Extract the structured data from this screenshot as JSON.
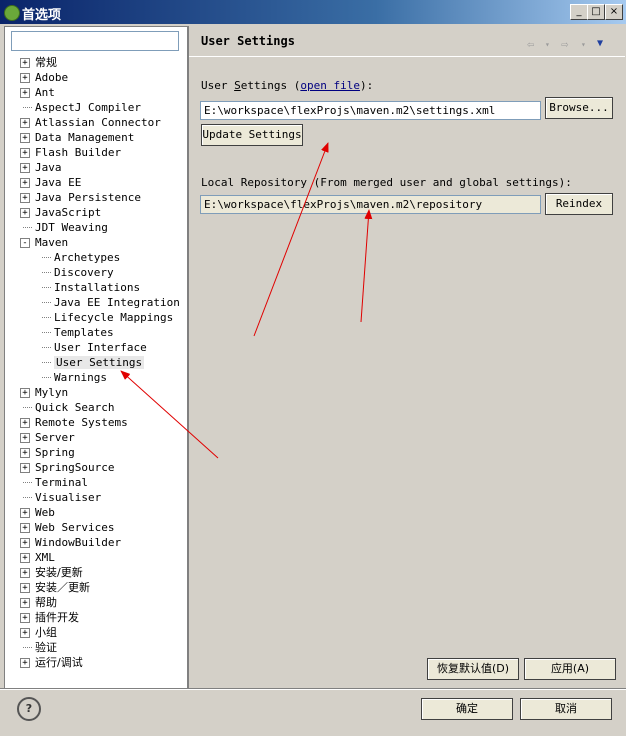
{
  "window": {
    "title": "首选项",
    "minimize": "_",
    "maximize": "□",
    "close": "×"
  },
  "tree": {
    "filter_value": "",
    "items": [
      {
        "label": "常规",
        "expander": "+",
        "level": 0
      },
      {
        "label": "Adobe",
        "expander": "+",
        "level": 0
      },
      {
        "label": "Ant",
        "expander": "+",
        "level": 0
      },
      {
        "label": "AspectJ Compiler",
        "expander": "",
        "level": 0
      },
      {
        "label": "Atlassian Connector",
        "expander": "+",
        "level": 0
      },
      {
        "label": "Data Management",
        "expander": "+",
        "level": 0
      },
      {
        "label": "Flash Builder",
        "expander": "+",
        "level": 0
      },
      {
        "label": "Java",
        "expander": "+",
        "level": 0
      },
      {
        "label": "Java EE",
        "expander": "+",
        "level": 0
      },
      {
        "label": "Java Persistence",
        "expander": "+",
        "level": 0
      },
      {
        "label": "JavaScript",
        "expander": "+",
        "level": 0
      },
      {
        "label": "JDT Weaving",
        "expander": "",
        "level": 0
      },
      {
        "label": "Maven",
        "expander": "-",
        "level": 0
      },
      {
        "label": "Archetypes",
        "expander": "",
        "level": 1
      },
      {
        "label": "Discovery",
        "expander": "",
        "level": 1
      },
      {
        "label": "Installations",
        "expander": "",
        "level": 1
      },
      {
        "label": "Java EE Integration",
        "expander": "",
        "level": 1
      },
      {
        "label": "Lifecycle Mappings",
        "expander": "",
        "level": 1
      },
      {
        "label": "Templates",
        "expander": "",
        "level": 1
      },
      {
        "label": "User Interface",
        "expander": "",
        "level": 1
      },
      {
        "label": "User Settings",
        "expander": "",
        "level": 1,
        "selected": true
      },
      {
        "label": "Warnings",
        "expander": "",
        "level": 1
      },
      {
        "label": "Mylyn",
        "expander": "+",
        "level": 0
      },
      {
        "label": "Quick Search",
        "expander": "",
        "level": 0
      },
      {
        "label": "Remote Systems",
        "expander": "+",
        "level": 0
      },
      {
        "label": "Server",
        "expander": "+",
        "level": 0
      },
      {
        "label": "Spring",
        "expander": "+",
        "level": 0
      },
      {
        "label": "SpringSource",
        "expander": "+",
        "level": 0
      },
      {
        "label": "Terminal",
        "expander": "",
        "level": 0
      },
      {
        "label": "Visualiser",
        "expander": "",
        "level": 0
      },
      {
        "label": "Web",
        "expander": "+",
        "level": 0
      },
      {
        "label": "Web Services",
        "expander": "+",
        "level": 0
      },
      {
        "label": "WindowBuilder",
        "expander": "+",
        "level": 0
      },
      {
        "label": "XML",
        "expander": "+",
        "level": 0
      },
      {
        "label": "安装/更新",
        "expander": "+",
        "level": 0
      },
      {
        "label": "安装／更新",
        "expander": "+",
        "level": 0
      },
      {
        "label": "帮助",
        "expander": "+",
        "level": 0
      },
      {
        "label": "插件开发",
        "expander": "+",
        "level": 0
      },
      {
        "label": "小组",
        "expander": "+",
        "level": 0
      },
      {
        "label": "验证",
        "expander": "",
        "level": 0
      },
      {
        "label": "运行/调试",
        "expander": "+",
        "level": 0
      }
    ]
  },
  "page": {
    "title": "User Settings",
    "user_settings_label_pre": "User ",
    "user_settings_label_mnemonic": "S",
    "user_settings_label_post": "ettings (",
    "open_file_link": "open file",
    "user_settings_label_end": "):",
    "user_settings_value": "E:\\workspace\\flexProjs\\maven.m2\\settings.xml",
    "browse_label": "Browse...",
    "update_settings_label": "Update Settings",
    "local_repo_label": "Local Repository (From merged user and global settings):",
    "local_repo_value": "E:\\workspace\\flexProjs\\maven.m2\\repository",
    "reindex_label": "Reindex",
    "restore_defaults_label": "恢复默认值(D)",
    "apply_label": "应用(A)"
  },
  "footer": {
    "help": "?",
    "ok_label": "确定",
    "cancel_label": "取消"
  },
  "colors": {
    "annotation_arrow": "#e00000",
    "titlebar": "#0a246a"
  }
}
